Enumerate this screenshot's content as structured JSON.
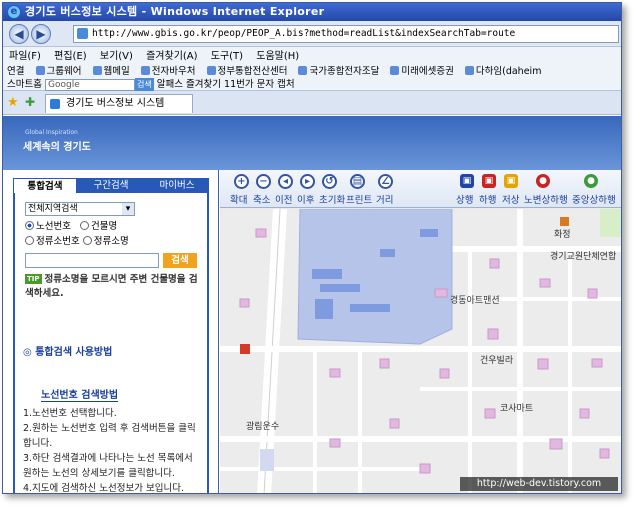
{
  "window": {
    "title": "경기도 버스정보 시스템 - Windows Internet Explorer"
  },
  "addressbar": {
    "url": "http://www.gbis.go.kr/peop/PEOP_A.bis?method=readList&indexSearchTab=route"
  },
  "menu": [
    "파일(F)",
    "편집(E)",
    "보기(V)",
    "즐겨찾기(A)",
    "도구(T)",
    "도움말(H)"
  ],
  "links": {
    "label": "연결",
    "items": [
      "그룹웨어",
      "웹메일",
      "전자바우처",
      "정부통합전산센터",
      "국가종합전자조달",
      "미래에셋증권",
      "다하임(daheim"
    ]
  },
  "toolbar": {
    "search_placeholder": "Google",
    "search_button": "검색",
    "items": [
      "스마트홈",
      "알패스",
      "즐겨찾기",
      "11번가",
      "문자",
      "캡처"
    ]
  },
  "tab": {
    "title": "경기도 버스정보 시스템"
  },
  "site": {
    "brand_small": "Global Inspiration",
    "brand": "세계속의 경기도"
  },
  "search": {
    "tabs": [
      "통합검색",
      "구간검색",
      "마이버스"
    ],
    "region_select": "전체지역검색",
    "radios": [
      {
        "label": "노선번호",
        "checked": true
      },
      {
        "label": "건물명",
        "checked": false
      },
      {
        "label": "정류소번호",
        "checked": false
      },
      {
        "label": "정류소명",
        "checked": false
      }
    ],
    "button": "검색",
    "tip_badge": "TIP",
    "tip": "정류소명을 모르시면 주변 건물명을 검색하세요.",
    "usage_title": "통합검색 사용방법",
    "route_title": "노선번호 검색방법",
    "steps": [
      "1.노선번호 선택합니다.",
      "2.원하는 노선번호 입력 후 검색버튼을 클릭합니다.",
      "3.하단 검색결과에 나타나는 노선 목록에서 원하는 노선의 상세보기를 클릭합니다.",
      "4.지도에 검색하신 노선정보가 보입니다."
    ]
  },
  "map": {
    "tools": [
      "확대",
      "축소",
      "이전",
      "이후",
      "초기화",
      "프린트",
      "거리"
    ],
    "tool_icons": [
      "zoom-in-icon",
      "zoom-out-icon",
      "back-icon",
      "forward-icon",
      "reset-icon",
      "print-icon",
      "distance-icon"
    ],
    "vehicle_tools": [
      "상행",
      "하행",
      "저상",
      "노변상하행",
      "중앙상하행"
    ],
    "labels": [
      "화정",
      "경기교원단체연합",
      "경동아트맨션",
      "건우빌라",
      "코사마트",
      "광림운수"
    ]
  },
  "watermark": "http://web-dev.tistory.com"
}
